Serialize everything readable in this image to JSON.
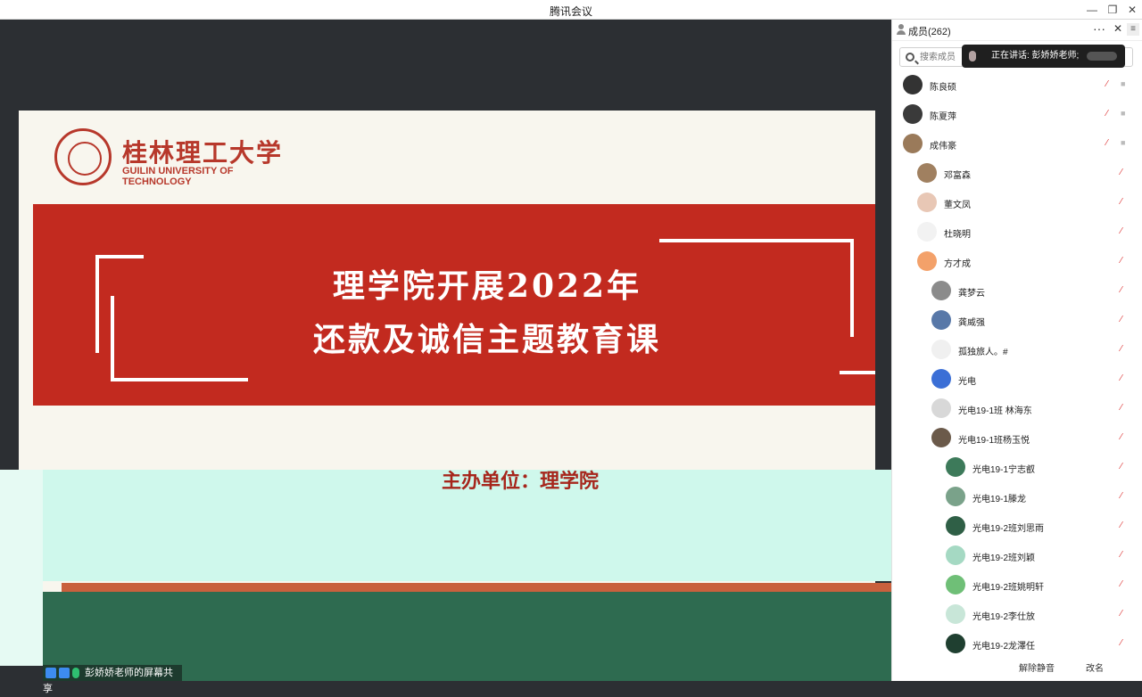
{
  "window": {
    "title": "腾讯会议",
    "min_icon": "—",
    "max_icon": "❐",
    "close_icon": "✕"
  },
  "slide": {
    "logo_cn": "桂林理工大学",
    "logo_en": "GUILIN UNIVERSITY OF TECHNOLOGY",
    "line1": "理学院开展2022年",
    "line2": "还款及诚信主题教育课",
    "organizer": "主办单位：理学院",
    "accent_red": "#c22a1f"
  },
  "share_bar": {
    "label": "彭娇娇老师的屏幕共享"
  },
  "panel": {
    "title": "成员(262)",
    "more": "···",
    "close": "✕",
    "menu": "≡",
    "search_placeholder": "搜索成员",
    "speaking": "正在讲话: 彭娇娇老师;",
    "members": [
      {
        "name": "陈良硕",
        "avatar_color": "#333333"
      },
      {
        "name": "陈夏萍",
        "avatar_color": "#3a3a3a"
      },
      {
        "name": "成伟豪",
        "avatar_color": "#9a7a5a"
      },
      {
        "name": "邓富森",
        "avatar_color": "#a08060"
      },
      {
        "name": "董文凤",
        "avatar_color": "#e8c7b5"
      },
      {
        "name": "杜晓明",
        "avatar_color": "#f2f2f2"
      },
      {
        "name": "方才成",
        "avatar_color": "#f3a16a"
      },
      {
        "name": "龚梦云",
        "avatar_color": "#8b8b8b"
      },
      {
        "name": "龚威强",
        "avatar_color": "#5878a8"
      },
      {
        "name": "孤独旅人。#",
        "avatar_color": "#f0f0f0"
      },
      {
        "name": "光电",
        "avatar_color": "#3b6fd6"
      },
      {
        "name": "光电19-1班 林海东",
        "avatar_color": "#d8d8d8"
      },
      {
        "name": "光电19-1班杨玉悦",
        "avatar_color": "#6b5a4a"
      },
      {
        "name": "光电19-1宁志叡",
        "avatar_color": "#3d7a5a"
      },
      {
        "name": "光电19-1滕龙",
        "avatar_color": "#7aa28a"
      },
      {
        "name": "光电19-2班刘思雨",
        "avatar_color": "#2f5f46"
      },
      {
        "name": "光电19-2班刘颖",
        "avatar_color": "#a5d9c3"
      },
      {
        "name": "光电19-2班姚明轩",
        "avatar_color": "#6fbf77"
      },
      {
        "name": "光电19-2李仕放",
        "avatar_color": "#c8e6d8"
      },
      {
        "name": "光电19-2龙澤任",
        "avatar_color": "#1f3f30"
      }
    ],
    "unmute_label": "解除静音",
    "rename_label": "改名"
  }
}
